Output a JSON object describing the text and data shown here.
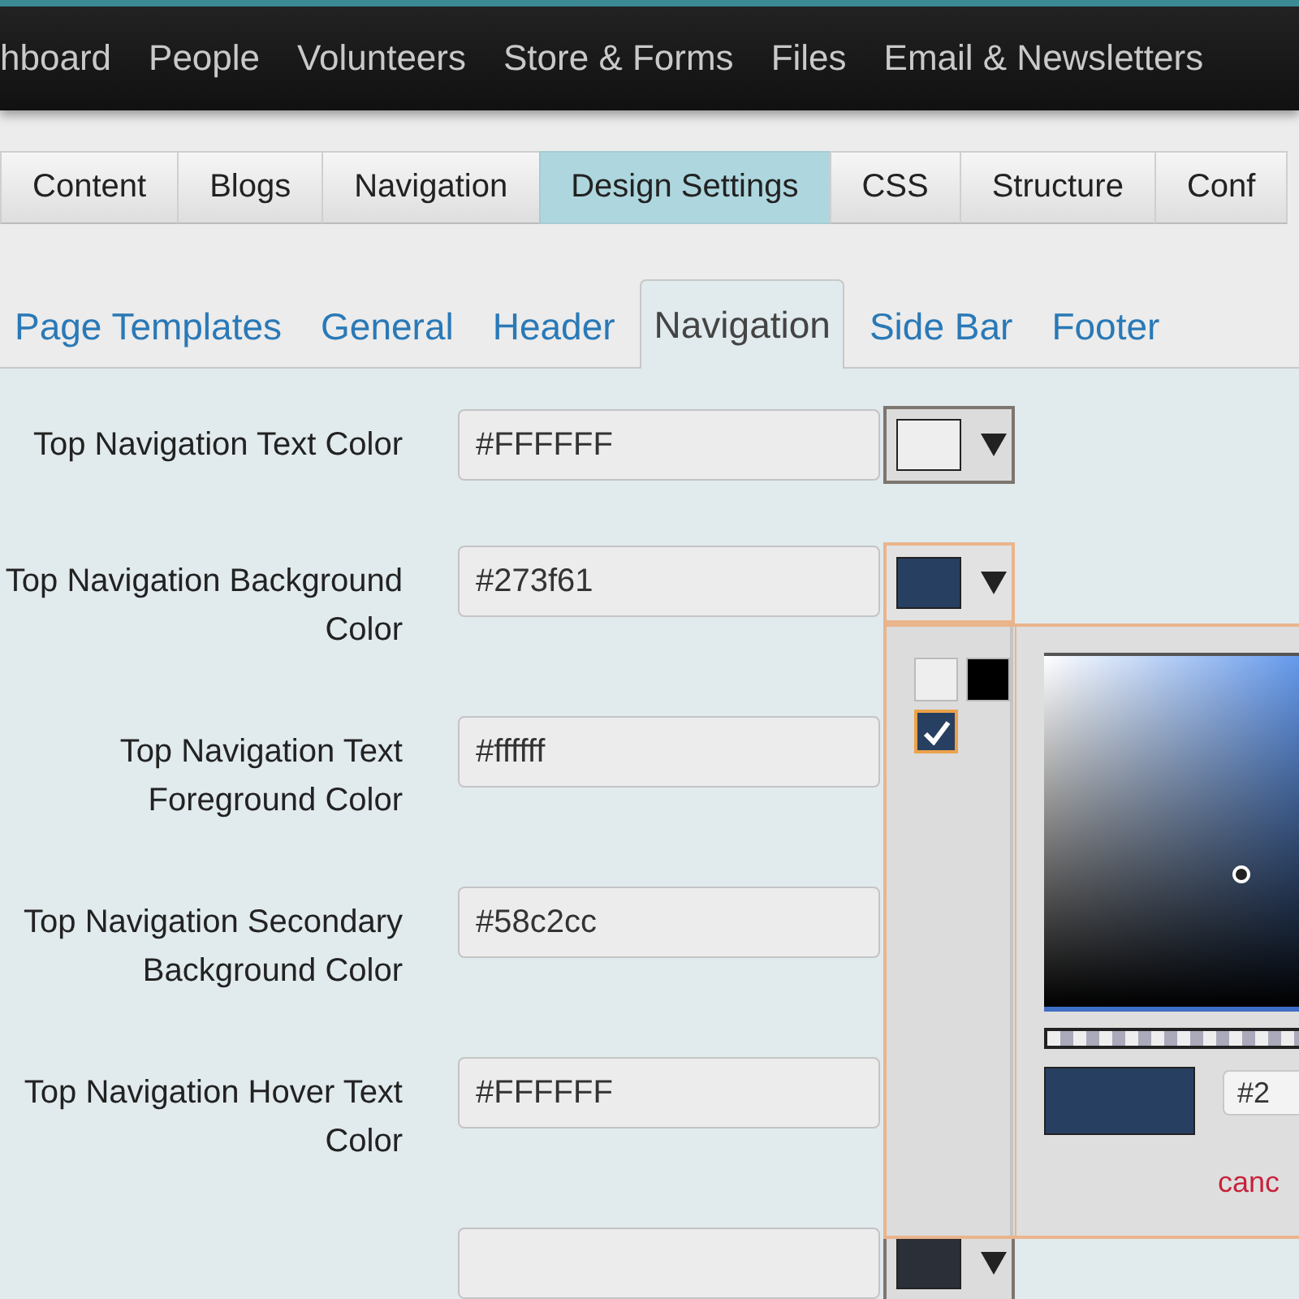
{
  "top_nav": {
    "items": [
      "hboard",
      "People",
      "Volunteers",
      "Store & Forms",
      "Files",
      "Email & Newsletters"
    ]
  },
  "main_tabs": [
    {
      "label": "Content",
      "selected": false
    },
    {
      "label": "Blogs",
      "selected": false
    },
    {
      "label": "Navigation",
      "selected": false
    },
    {
      "label": "Design Settings",
      "selected": true
    },
    {
      "label": "CSS",
      "selected": false
    },
    {
      "label": "Structure",
      "selected": false
    },
    {
      "label": "Conf",
      "selected": false
    }
  ],
  "sub_tabs": [
    {
      "label": "Page Templates",
      "selected": false
    },
    {
      "label": "General",
      "selected": false
    },
    {
      "label": "Header",
      "selected": false
    },
    {
      "label": "Navigation",
      "selected": true
    },
    {
      "label": "Side Bar",
      "selected": false
    },
    {
      "label": "Footer",
      "selected": false
    }
  ],
  "fields": [
    {
      "label": "Top Navigation Text Color",
      "value": "#FFFFFF",
      "picker": {
        "color": "#eeeeee",
        "open": false
      }
    },
    {
      "label": "Top Navigation Background Color",
      "value": "#273f61",
      "picker": {
        "color": "#273f61",
        "open": true
      }
    },
    {
      "label": "Top Navigation Text Foreground Color",
      "value": "#ffffff"
    },
    {
      "label": "Top Navigation Secondary Background Color",
      "value": "#58c2cc"
    },
    {
      "label": "Top Navigation Hover Text Color",
      "value": "#FFFFFF"
    },
    {
      "picker": {
        "color": "#2b3038",
        "open": false
      }
    }
  ],
  "color_popup": {
    "palette": [
      {
        "color": "#eeeeee",
        "selected": false
      },
      {
        "color": "#000000",
        "selected": false
      },
      {
        "color": "#273f61",
        "selected": true
      }
    ],
    "preview": {
      "color": "#273f61"
    },
    "hex_value": "#2",
    "cancel": "canc"
  }
}
